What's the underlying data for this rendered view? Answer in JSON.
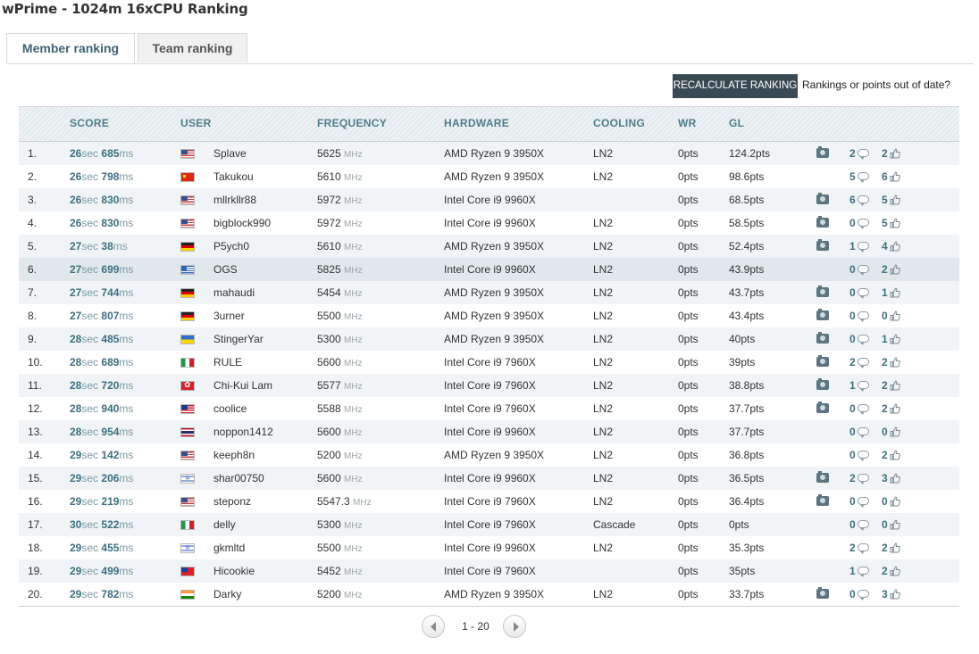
{
  "page": {
    "title": "wPrime - 1024m 16xCPU Ranking"
  },
  "tabs": [
    {
      "label": "Member ranking",
      "active": true
    },
    {
      "label": "Team ranking",
      "active": false
    }
  ],
  "toolbar": {
    "recalculate_label": "RECALCULATE RANKING",
    "outdated_text": "Rankings or points out of date?"
  },
  "table": {
    "headers": {
      "score": "SCORE",
      "user": "USER",
      "frequency": "FREQUENCY",
      "hardware": "HARDWARE",
      "cooling": "COOLING",
      "wr": "WR",
      "gl": "GL"
    },
    "units": {
      "sec": "sec",
      "ms": "ms",
      "mhz": "MHz"
    },
    "rows": [
      {
        "rank": "1.",
        "sec": "26",
        "ms": "685",
        "flag": "us",
        "user": "Splave",
        "freq": "5625",
        "hardware": "AMD Ryzen 9 3950X",
        "cooling": "LN2",
        "wr": "0pts",
        "gl": "124.2pts",
        "camera": true,
        "comments": "2",
        "likes": "2"
      },
      {
        "rank": "2.",
        "sec": "26",
        "ms": "798",
        "flag": "cn",
        "user": "Takukou",
        "freq": "5610",
        "hardware": "AMD Ryzen 9 3950X",
        "cooling": "LN2",
        "wr": "0pts",
        "gl": "98.6pts",
        "camera": false,
        "comments": "5",
        "likes": "6"
      },
      {
        "rank": "3.",
        "sec": "26",
        "ms": "830",
        "flag": "us",
        "user": "mllrkllr88",
        "freq": "5972",
        "hardware": "Intel Core i9 9960X",
        "cooling": "",
        "wr": "0pts",
        "gl": "68.5pts",
        "camera": true,
        "comments": "6",
        "likes": "5"
      },
      {
        "rank": "4.",
        "sec": "26",
        "ms": "830",
        "flag": "us",
        "user": "bigblock990",
        "freq": "5972",
        "hardware": "Intel Core i9 9960X",
        "cooling": "LN2",
        "wr": "0pts",
        "gl": "58.5pts",
        "camera": true,
        "comments": "0",
        "likes": "5"
      },
      {
        "rank": "5.",
        "sec": "27",
        "ms": "38",
        "flag": "de",
        "user": "P5ych0",
        "freq": "5610",
        "hardware": "AMD Ryzen 9 3950X",
        "cooling": "LN2",
        "wr": "0pts",
        "gl": "52.4pts",
        "camera": true,
        "comments": "1",
        "likes": "4"
      },
      {
        "rank": "6.",
        "sec": "27",
        "ms": "699",
        "flag": "gr",
        "user": "OGS",
        "freq": "5825",
        "hardware": "Intel Core i9 9960X",
        "cooling": "LN2",
        "wr": "0pts",
        "gl": "43.9pts",
        "camera": false,
        "comments": "0",
        "likes": "2",
        "highlight": true
      },
      {
        "rank": "7.",
        "sec": "27",
        "ms": "744",
        "flag": "de",
        "user": "mahaudi",
        "freq": "5454",
        "hardware": "AMD Ryzen 9 3950X",
        "cooling": "LN2",
        "wr": "0pts",
        "gl": "43.7pts",
        "camera": true,
        "comments": "0",
        "likes": "1"
      },
      {
        "rank": "8.",
        "sec": "27",
        "ms": "807",
        "flag": "de",
        "user": "3urner",
        "freq": "5500",
        "hardware": "AMD Ryzen 9 3950X",
        "cooling": "LN2",
        "wr": "0pts",
        "gl": "43.4pts",
        "camera": true,
        "comments": "0",
        "likes": "0"
      },
      {
        "rank": "9.",
        "sec": "28",
        "ms": "485",
        "flag": "ua",
        "user": "StingerYar",
        "freq": "5300",
        "hardware": "AMD Ryzen 9 3950X",
        "cooling": "LN2",
        "wr": "0pts",
        "gl": "40pts",
        "camera": true,
        "comments": "0",
        "likes": "1"
      },
      {
        "rank": "10.",
        "sec": "28",
        "ms": "689",
        "flag": "it",
        "user": "RULE",
        "freq": "5600",
        "hardware": "Intel Core i9 7960X",
        "cooling": "LN2",
        "wr": "0pts",
        "gl": "39pts",
        "camera": true,
        "comments": "2",
        "likes": "2"
      },
      {
        "rank": "11.",
        "sec": "28",
        "ms": "720",
        "flag": "hk",
        "user": "Chi-Kui Lam",
        "freq": "5577",
        "hardware": "Intel Core i9 7960X",
        "cooling": "LN2",
        "wr": "0pts",
        "gl": "38.8pts",
        "camera": true,
        "comments": "1",
        "likes": "2"
      },
      {
        "rank": "12.",
        "sec": "28",
        "ms": "940",
        "flag": "my",
        "user": "coolice",
        "freq": "5588",
        "hardware": "Intel Core i9 7960X",
        "cooling": "LN2",
        "wr": "0pts",
        "gl": "37.7pts",
        "camera": true,
        "comments": "0",
        "likes": "2"
      },
      {
        "rank": "13.",
        "sec": "28",
        "ms": "954",
        "flag": "th",
        "user": "noppon1412",
        "freq": "5600",
        "hardware": "Intel Core i9 9960X",
        "cooling": "LN2",
        "wr": "0pts",
        "gl": "37.7pts",
        "camera": false,
        "comments": "0",
        "likes": "0"
      },
      {
        "rank": "14.",
        "sec": "29",
        "ms": "142",
        "flag": "us",
        "user": "keeph8n",
        "freq": "5200",
        "hardware": "AMD Ryzen 9 3950X",
        "cooling": "LN2",
        "wr": "0pts",
        "gl": "36.8pts",
        "camera": false,
        "comments": "0",
        "likes": "2"
      },
      {
        "rank": "15.",
        "sec": "29",
        "ms": "206",
        "flag": "il",
        "user": "shar00750",
        "freq": "5600",
        "hardware": "Intel Core i9 9960X",
        "cooling": "LN2",
        "wr": "0pts",
        "gl": "36.5pts",
        "camera": true,
        "comments": "2",
        "likes": "3"
      },
      {
        "rank": "16.",
        "sec": "29",
        "ms": "219",
        "flag": "us",
        "user": "steponz",
        "freq": "5547.3",
        "hardware": "Intel Core i9 7960X",
        "cooling": "LN2",
        "wr": "0pts",
        "gl": "36.4pts",
        "camera": true,
        "comments": "0",
        "likes": "0"
      },
      {
        "rank": "17.",
        "sec": "30",
        "ms": "522",
        "flag": "it",
        "user": "delly",
        "freq": "5300",
        "hardware": "Intel Core i9 7960X",
        "cooling": "Cascade",
        "wr": "0pts",
        "gl": "0pts",
        "camera": false,
        "comments": "0",
        "likes": "0"
      },
      {
        "rank": "18.",
        "sec": "29",
        "ms": "455",
        "flag": "il",
        "user": "gkmltd",
        "freq": "5500",
        "hardware": "Intel Core i9 9960X",
        "cooling": "LN2",
        "wr": "0pts",
        "gl": "35.3pts",
        "camera": false,
        "comments": "2",
        "likes": "2"
      },
      {
        "rank": "19.",
        "sec": "29",
        "ms": "499",
        "flag": "tw",
        "user": "Hicookie",
        "freq": "5452",
        "hardware": "Intel Core i9 7960X",
        "cooling": "",
        "wr": "0pts",
        "gl": "35pts",
        "camera": false,
        "comments": "1",
        "likes": "2"
      },
      {
        "rank": "20.",
        "sec": "29",
        "ms": "782",
        "flag": "in",
        "user": "Darky",
        "freq": "5200",
        "hardware": "AMD Ryzen 9 3950X",
        "cooling": "LN2",
        "wr": "0pts",
        "gl": "33.7pts",
        "camera": true,
        "comments": "0",
        "likes": "3"
      }
    ]
  },
  "pagination": {
    "label": "1 - 20"
  },
  "colors": {
    "accent": "#3d6f80",
    "button_bg": "#3a4a55",
    "header_text": "#4f7c8a",
    "row_alt": "#f0f4f6"
  }
}
